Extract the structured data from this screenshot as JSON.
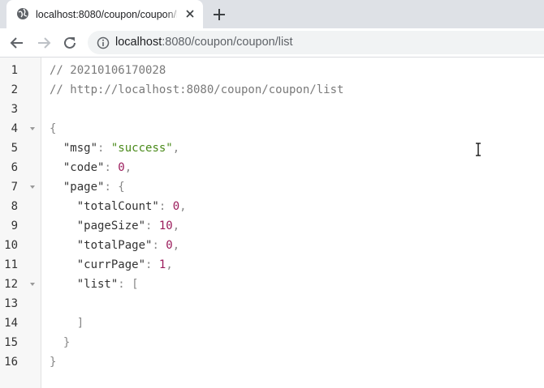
{
  "browser": {
    "tab": {
      "title": "localhost:8080/coupon/coupon/list",
      "favicon": "globe-icon",
      "close_icon": "close-icon"
    },
    "new_tab_icon": "plus-icon",
    "toolbar": {
      "back_icon": "back-arrow-icon",
      "forward_icon": "forward-arrow-icon",
      "reload_icon": "reload-icon",
      "site_info_icon": "info-icon",
      "url_host": "localhost",
      "url_rest": ":8080/coupon/coupon/list"
    }
  },
  "viewer": {
    "line_numbers": [
      "1",
      "2",
      "3",
      "4",
      "5",
      "6",
      "7",
      "8",
      "9",
      "10",
      "11",
      "12",
      "13",
      "14",
      "15",
      "16"
    ],
    "comments": {
      "timestamp": "// 20210106170028",
      "source_url": "// http://localhost:8080/coupon/coupon/list"
    },
    "json": {
      "open_brace": "{",
      "msg_key": "\"msg\"",
      "msg_value": "\"success\"",
      "code_key": "\"code\"",
      "code_value": "0",
      "page_key": "\"page\"",
      "totalCount_key": "\"totalCount\"",
      "totalCount_value": "0",
      "pageSize_key": "\"pageSize\"",
      "pageSize_value": "10",
      "totalPage_key": "\"totalPage\"",
      "totalPage_value": "0",
      "currPage_key": "\"currPage\"",
      "currPage_value": "1",
      "list_key": "\"list\"",
      "list_open": "[",
      "list_close": "]",
      "page_close": "}",
      "close_brace": "}"
    },
    "colors": {
      "string": "#4a8a1a",
      "number": "#9b1b5b",
      "comment": "#7a7a7a"
    }
  }
}
